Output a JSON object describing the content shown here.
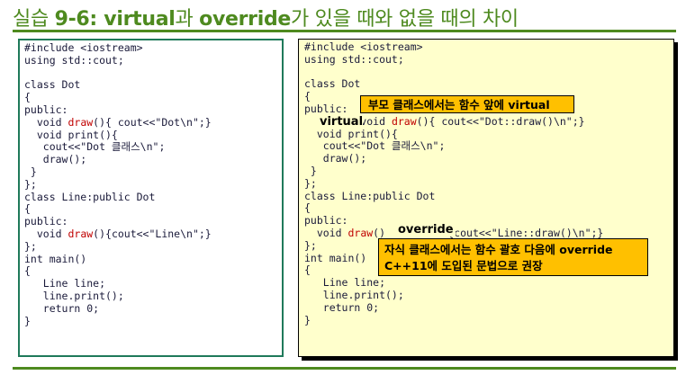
{
  "title": {
    "prefix": "실습 ",
    "number": "9-6: ",
    "virtual_word": "virtual",
    "mid": "과 ",
    "override_word": "override",
    "suffix": "가 있을 때와 없을 때의 차이"
  },
  "left_code": {
    "l1": "#include <iostream>",
    "l2": "using std::cout;",
    "l3": "",
    "l4": "class Dot",
    "l5": "{",
    "l6": "public:",
    "l7a": "  void ",
    "l7b": "draw",
    "l7c": "(){ cout<<\"Dot\\n\";}",
    "l8": "  void print(){",
    "l9": "   cout<<\"Dot 클래스\\n\";",
    "l10": "   draw();",
    "l11": " }",
    "l12": "};",
    "l13": "class Line:public Dot",
    "l14": "{",
    "l15": "public:",
    "l16a": "  void ",
    "l16b": "draw",
    "l16c": "(){cout<<\"Line\\n\";}",
    "l17": "};",
    "l18": "int main()",
    "l19": "{",
    "l20": "   Line line;",
    "l21": "   line.print();",
    "l22": "   return 0;",
    "l23": "}"
  },
  "right_code": {
    "l1": "#include <iostream>",
    "l2": "using std::cout;",
    "l3": "",
    "l4": "class Dot",
    "l5": "{",
    "l6": "public:",
    "l7a": "         void ",
    "l7b": "draw",
    "l7c": "(){ cout<<\"Dot::draw()\\n\";}",
    "l8": "  void print(){",
    "l9": "   cout<<\"Dot 클래스\\n\";",
    "l10": "   draw();",
    "l11": " }",
    "l12": "};",
    "l13": "class Line:public Dot",
    "l14": "{",
    "l15": "public:",
    "l16a": "  void ",
    "l16b": "draw",
    "l16c": "()          {cout<<\"Line::draw()\\n\";}",
    "l17": "};",
    "l18": "int main()",
    "l19": "{",
    "l20": "   Line line;",
    "l21": "   line.print();",
    "l22": "   return 0;",
    "l23": "}"
  },
  "annotations": {
    "virtual_keyword": "virtual",
    "override_keyword": "override",
    "callout_virtual": "부모 클래스에서는 함수 앞에 virtual",
    "callout_override_line1": "자식 클래스에서는 함수 괄호 다음에 override",
    "callout_override_line2": "C++11에 도입된 문법으로 권장"
  },
  "colors": {
    "title_green": "#4e8a1f",
    "right_panel_bg": "#ffffcc",
    "callout_bg": "#ffc000",
    "draw_red": "#c00000"
  }
}
